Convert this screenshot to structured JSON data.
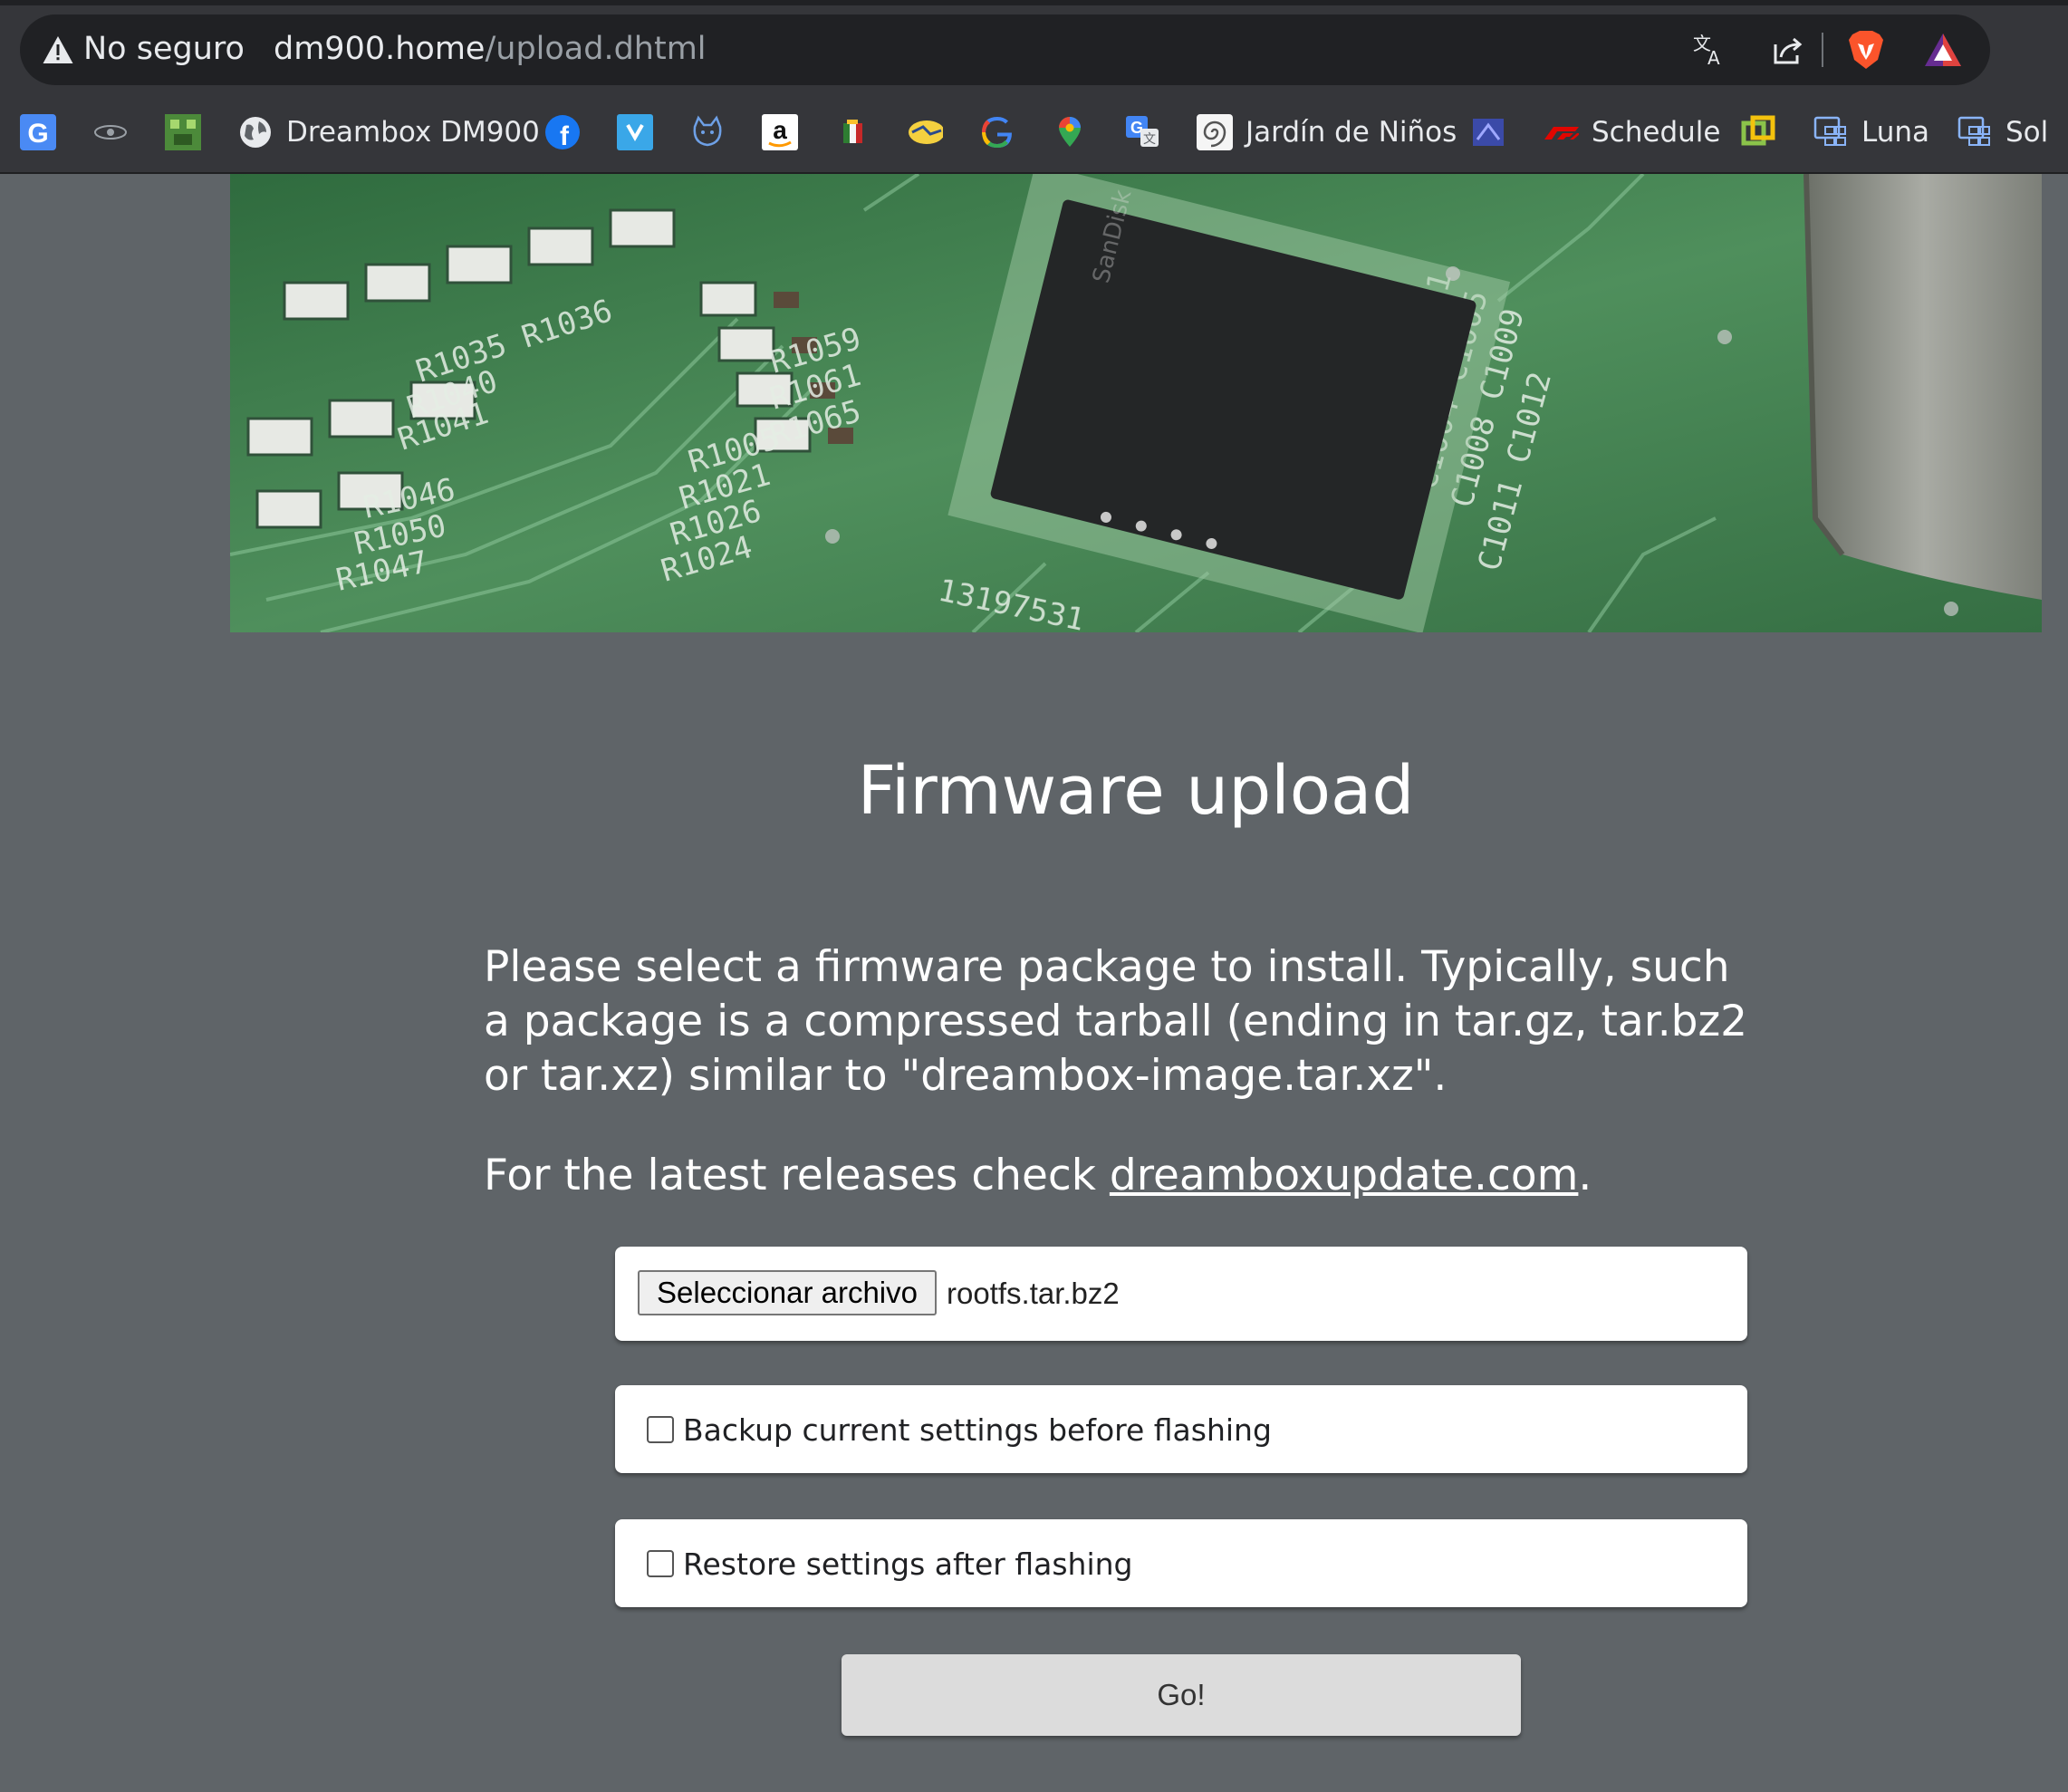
{
  "browser": {
    "security_label": "No seguro",
    "url_host": "dm900.home",
    "url_path": "/upload.dhtml",
    "bookmarks": [
      {
        "icon": "google-g-icon",
        "label": ""
      },
      {
        "icon": "eye-icon",
        "label": ""
      },
      {
        "icon": "pixel-game-icon",
        "label": ""
      },
      {
        "icon": "globe-icon",
        "label": "Dreambox DM900"
      },
      {
        "icon": "facebook-icon",
        "label": ""
      },
      {
        "icon": "blue-app-icon",
        "label": ""
      },
      {
        "icon": "cat-face-icon",
        "label": ""
      },
      {
        "icon": "amazon-icon",
        "label": ""
      },
      {
        "icon": "flag-icon",
        "label": ""
      },
      {
        "icon": "handshake-icon",
        "label": ""
      },
      {
        "icon": "google-icon",
        "label": ""
      },
      {
        "icon": "maps-pin-icon",
        "label": ""
      },
      {
        "icon": "translate-icon",
        "label": ""
      },
      {
        "icon": "swirl-icon",
        "label": "Jardín de Niños"
      },
      {
        "icon": "purple-app-icon",
        "label": ""
      },
      {
        "icon": "f1-icon",
        "label": "Schedule"
      },
      {
        "icon": "vmware-icon",
        "label": ""
      },
      {
        "icon": "dashboard-icon",
        "label": "Luna"
      },
      {
        "icon": "dashboard-icon",
        "label": "Sol"
      }
    ]
  },
  "page": {
    "title": "Firmware upload",
    "intro": "Please select a firmware package to install. Typically, such a package is a compressed tarball (ending in tar.gz, tar.bz2 or tar.xz) similar to \"dreambox-image.tar.xz\".",
    "latest_prefix": "For the latest releases check ",
    "latest_link": "dreamboxupdate.com",
    "latest_suffix": ".",
    "file_button": "Seleccionar archivo",
    "file_name": "rootfs.tar.bz2",
    "backup_label": "Backup current settings before flashing",
    "backup_checked": false,
    "restore_label": "Restore settings after flashing",
    "restore_checked": false,
    "go_label": "Go!"
  },
  "colors": {
    "page_background": "#5f6468",
    "chrome_background": "#35363a",
    "omnibox_background": "#202124",
    "pcb_green": "#3f7a4c"
  }
}
